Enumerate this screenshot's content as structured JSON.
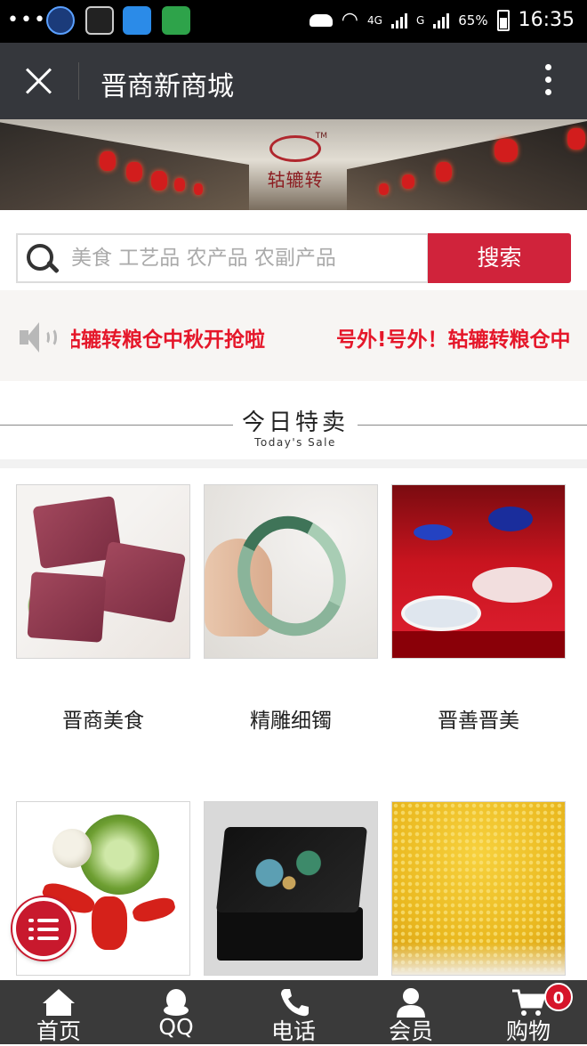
{
  "status_bar": {
    "battery": "65%",
    "time": "16:35",
    "network_a": "4G",
    "network_b": "G"
  },
  "titlebar": {
    "title": "晋商新商城"
  },
  "banner": {
    "brand": "轱辘转",
    "tm": "TM"
  },
  "search": {
    "placeholder": "美食 工艺品 农产品 农副产品",
    "button_label": "搜索"
  },
  "notice": {
    "text_1": "轱辘转粮仓中秋开抢啦",
    "text_2": "号外!号外！轱辘转粮仓中"
  },
  "section": {
    "title": "今日特卖",
    "subtitle": "Today's Sale"
  },
  "products": [
    {
      "name": "晋商美食"
    },
    {
      "name": "精雕细镯"
    },
    {
      "name": "晋善晋美"
    },
    {
      "name": ""
    },
    {
      "name": ""
    },
    {
      "name": ""
    }
  ],
  "bottom_nav": {
    "items": [
      {
        "label": "首页",
        "icon": "home-icon"
      },
      {
        "label": "QQ",
        "icon": "qq-icon"
      },
      {
        "label": "电话",
        "icon": "phone-icon"
      },
      {
        "label": "会员",
        "icon": "member-icon"
      },
      {
        "label": "购物",
        "icon": "cart-icon"
      }
    ],
    "cart_count": "0"
  },
  "colors": {
    "accent_red": "#d0233b",
    "titlebar_bg": "#35373c",
    "nav_bg": "#3a3a3a",
    "notice_red": "#e5172a"
  }
}
